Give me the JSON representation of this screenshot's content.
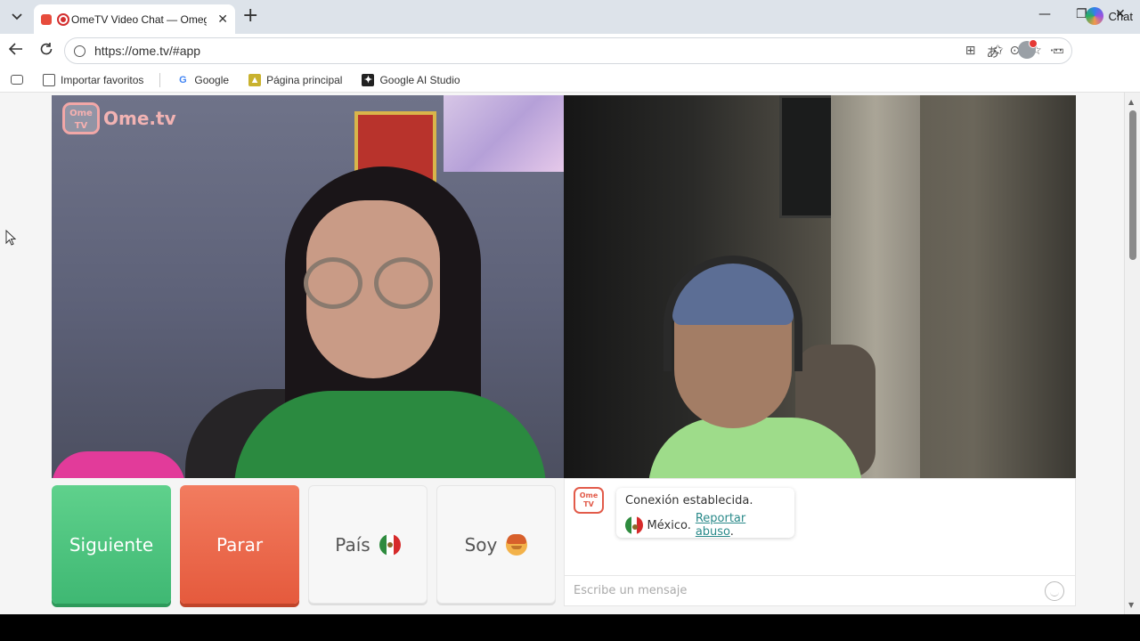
{
  "browser": {
    "tab_title": "OmeTV Video Chat — Omegl",
    "tab_close": "✕",
    "new_tab": "+",
    "url": "https://ome.tv/#app",
    "copilot_label": "Chat",
    "window_controls": {
      "minimize": "—",
      "restore": "❐",
      "close": "✕"
    }
  },
  "bookmarks": [
    {
      "label": "Importar favoritos",
      "icon": "import-icon"
    },
    {
      "label": "Google",
      "icon": "google-icon"
    },
    {
      "label": "Página principal",
      "icon": "home-page-icon"
    },
    {
      "label": "Google AI Studio",
      "icon": "ai-studio-icon"
    }
  ],
  "app": {
    "logo_text": "Ome.tv",
    "logo_badge": "Ome TV",
    "buttons": {
      "next": "Siguiente",
      "stop": "Parar",
      "country": "País",
      "gender": "Soy"
    },
    "chat": {
      "status": "Conexión establecida.",
      "country": "México.",
      "report": "Reportar abuso",
      "report_suffix": ".",
      "input_placeholder": "Escribe un mensaje"
    }
  },
  "colors": {
    "next_button": "#3fb873",
    "stop_button": "#e55a3d",
    "link": "#2a8a8a",
    "logo": "#f2a7a7"
  }
}
